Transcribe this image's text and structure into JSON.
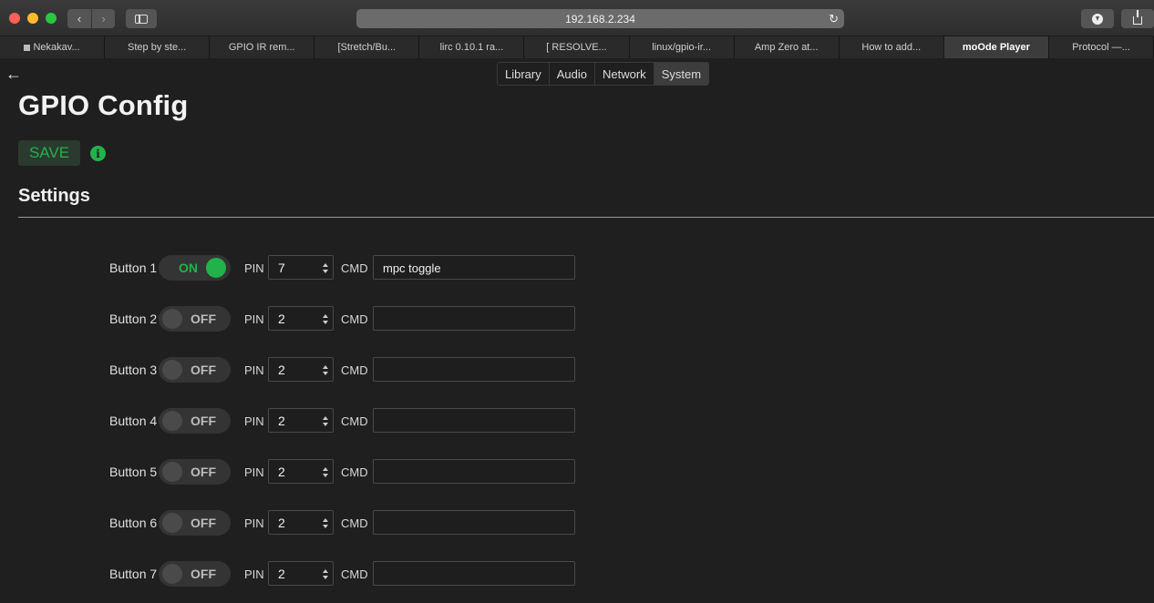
{
  "browser": {
    "url": "192.168.2.234",
    "tabs": [
      {
        "label": "Nekakav...",
        "active": false
      },
      {
        "label": "Step by ste...",
        "active": false
      },
      {
        "label": "GPIO IR rem...",
        "active": false
      },
      {
        "label": "[Stretch/Bu...",
        "active": false
      },
      {
        "label": "lirc 0.10.1 ra...",
        "active": false
      },
      {
        "label": "[ RESOLVE...",
        "active": false
      },
      {
        "label": "linux/gpio-ir...",
        "active": false
      },
      {
        "label": "Amp Zero at...",
        "active": false
      },
      {
        "label": "How to add...",
        "active": false
      },
      {
        "label": "moOde Player",
        "active": true
      },
      {
        "label": "Protocol —...",
        "active": false
      }
    ]
  },
  "page": {
    "back_glyph": "←",
    "nav": [
      {
        "label": "Library",
        "active": false
      },
      {
        "label": "Audio",
        "active": false
      },
      {
        "label": "Network",
        "active": false
      },
      {
        "label": "System",
        "active": true
      }
    ],
    "title": "GPIO Config",
    "save_label": "SAVE",
    "info_glyph": "i",
    "section_title": "Settings",
    "pin_label": "PIN",
    "cmd_label": "CMD",
    "buttons": [
      {
        "label": "Button 1",
        "state": "ON",
        "pin": "7",
        "cmd": "mpc toggle"
      },
      {
        "label": "Button 2",
        "state": "OFF",
        "pin": "2",
        "cmd": ""
      },
      {
        "label": "Button 3",
        "state": "OFF",
        "pin": "2",
        "cmd": ""
      },
      {
        "label": "Button 4",
        "state": "OFF",
        "pin": "2",
        "cmd": ""
      },
      {
        "label": "Button 5",
        "state": "OFF",
        "pin": "2",
        "cmd": ""
      },
      {
        "label": "Button 6",
        "state": "OFF",
        "pin": "2",
        "cmd": ""
      },
      {
        "label": "Button 7",
        "state": "OFF",
        "pin": "2",
        "cmd": ""
      }
    ]
  },
  "colors": {
    "accent": "#22b24c",
    "background": "#1f1f1f"
  }
}
